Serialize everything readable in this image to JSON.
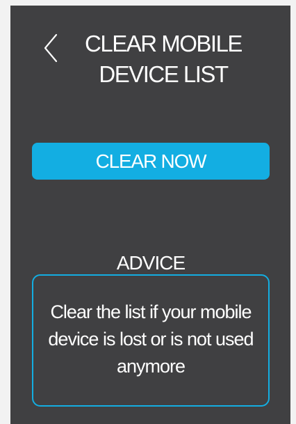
{
  "header": {
    "back_icon": "chevron-left-icon",
    "title": "CLEAR MOBILE DEVICE LIST"
  },
  "actions": {
    "clear_label": "CLEAR NOW"
  },
  "advice": {
    "heading": "ADVICE",
    "text": "Clear the list if your mobile device is lost or is not used anymore"
  },
  "colors": {
    "background": "#404042",
    "accent": "#13aee2",
    "text": "#ffffff"
  }
}
